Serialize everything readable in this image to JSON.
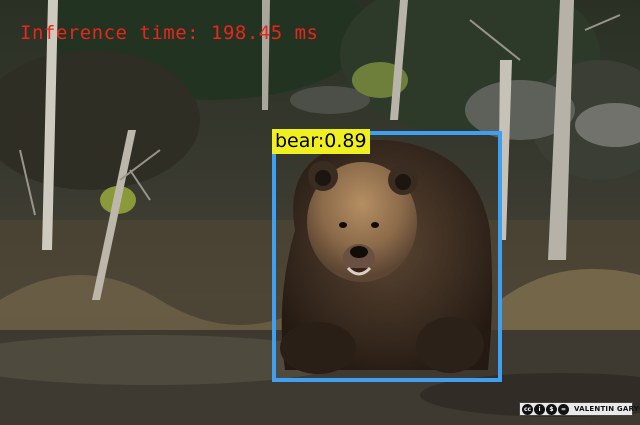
{
  "overlay": {
    "inference_text": "Inference time: 198.45 ms",
    "inference_color": "#e8261c"
  },
  "detection": {
    "label_text": "bear:0.89",
    "box_color": "#3f9ff0",
    "label_background": "#f0f021",
    "label_text_color": "#000000"
  },
  "license": {
    "badge_icons": [
      "creative-commons-icon",
      "attribution-icon",
      "noncommercial-icon",
      "noderivatives-icon"
    ],
    "author": "VALENTIN GARYGA"
  }
}
